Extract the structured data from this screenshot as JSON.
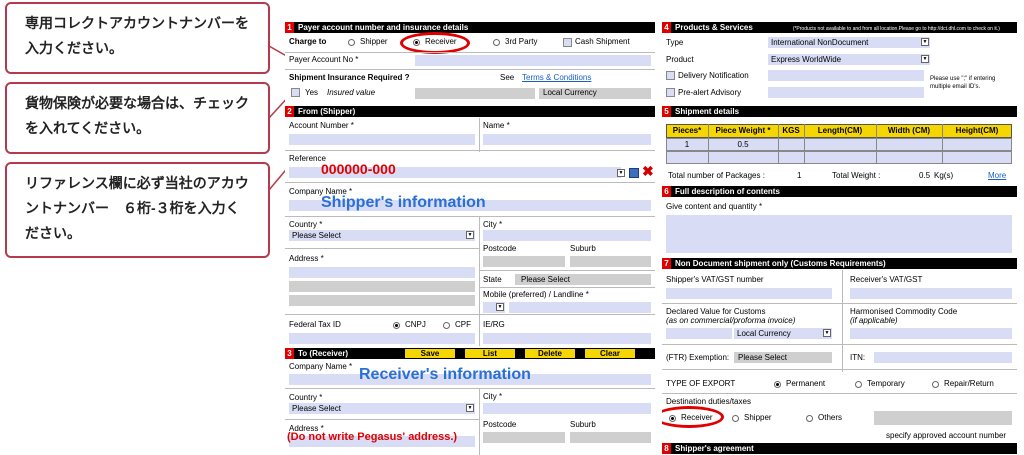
{
  "annotations": {
    "callout1": "専用コレクトアカウントナンバーを入力ください。",
    "callout2": "貨物保険が必要な場合は、チェックを入れてください。",
    "callout3": "リファレンス欄に必ず当社のアカウントナンバー　６桁-３桁を入力ください。",
    "reference_value": "000000-000",
    "shipper_info": "Shipper's information",
    "receiver_info": "Receiver's information",
    "receiver_address_note": "(Do not write Pegasus' address.)",
    "colors": {
      "red": "#e00000",
      "blue": "#2a6fd6",
      "callout_border": "#b43a4c",
      "field": "#d8dcf4",
      "button": "#f6d600"
    }
  },
  "section1": {
    "num": "1",
    "title": "Payer account number and insurance details",
    "charge_to": "Charge to",
    "options": [
      "Shipper",
      "Receiver",
      "3rd Party"
    ],
    "cash_shipment": "Cash Shipment",
    "payer_account_no": "Payer Account No *",
    "insurance_required": "Shipment Insurance Required ?",
    "see": "See",
    "terms": "Terms & Conditions",
    "yes": "Yes",
    "insured_value": "Insured value",
    "local_currency": "Local Currency"
  },
  "section2": {
    "num": "2",
    "title": "From (Shipper)",
    "account_number": "Account Number *",
    "name": "Name *",
    "reference": "Reference",
    "company_name": "Company Name *",
    "country": "Country *",
    "country_value": "Please Select",
    "city": "City *",
    "postcode": "Postcode",
    "suburb": "Suburb",
    "address": "Address *",
    "state": "State",
    "state_value": "Please Select",
    "mobile": "Mobile (preferred) / Landline *",
    "federal_tax_id": "Federal Tax ID",
    "cnpj": "CNPJ",
    "cpf": "CPF",
    "ie_rg": "IE/RG"
  },
  "section3": {
    "num": "3",
    "title": "To (Receiver)",
    "buttons": [
      "Save",
      "List",
      "Delete",
      "Clear"
    ],
    "company_name": "Company Name *",
    "country": "Country *",
    "country_value": "Please Select",
    "city": "City *",
    "address": "Address *",
    "postcode": "Postcode",
    "suburb": "Suburb"
  },
  "section4": {
    "num": "4",
    "title": "Products & Services",
    "note": "(*Products not available to and from all location.Please go to http://dct.dhl.com to check on it.)",
    "type": "Type",
    "type_value": "International NonDocument",
    "product": "Product",
    "product_value": "Express WorldWide",
    "delivery_notification": "Delivery Notification",
    "prealert": "Pre-alert Advisory",
    "email_note_1": "Please use \";\" if entering",
    "email_note_2": "multiple email ID's."
  },
  "section5": {
    "num": "5",
    "title": "Shipment details",
    "columns": [
      "Pieces*",
      "Piece Weight *",
      "KGS",
      "Length(CM)",
      "Width (CM)",
      "Height(CM)"
    ],
    "row": [
      "1",
      "0.5"
    ],
    "total_packages_label": "Total number of Packages :",
    "total_packages": "1",
    "total_weight_label": "Total Weight :",
    "total_weight": "0.5",
    "kg": "Kg(s)",
    "more": "More"
  },
  "section6": {
    "num": "6",
    "title": "Full description of contents",
    "give_content": "Give content and quantity *"
  },
  "section7": {
    "num": "7",
    "title": "Non Document shipment only (Customs Requirements)",
    "shipper_vat": "Shipper's VAT/GST number",
    "receiver_vat": "Receiver's VAT/GST",
    "declared_value": "Declared Value for Customs",
    "declared_note": "(as on commercial/proforma invoice)",
    "local_currency": "Local Currency",
    "harmonised": "Harmonised Commodity Code",
    "if_applicable": "(if applicable)",
    "ftr": "(FTR) Exemption:",
    "ftr_value": "Please Select",
    "itn": "ITN:",
    "type_of_export": "TYPE OF EXPORT",
    "export_options": [
      "Permanent",
      "Temporary",
      "Repair/Return"
    ],
    "destination_duties": "Destination duties/taxes",
    "duty_options": [
      "Receiver",
      "Shipper",
      "Others"
    ],
    "specify_account": "specify approved account number"
  },
  "section8": {
    "num": "8",
    "title": "Shipper's agreement"
  }
}
